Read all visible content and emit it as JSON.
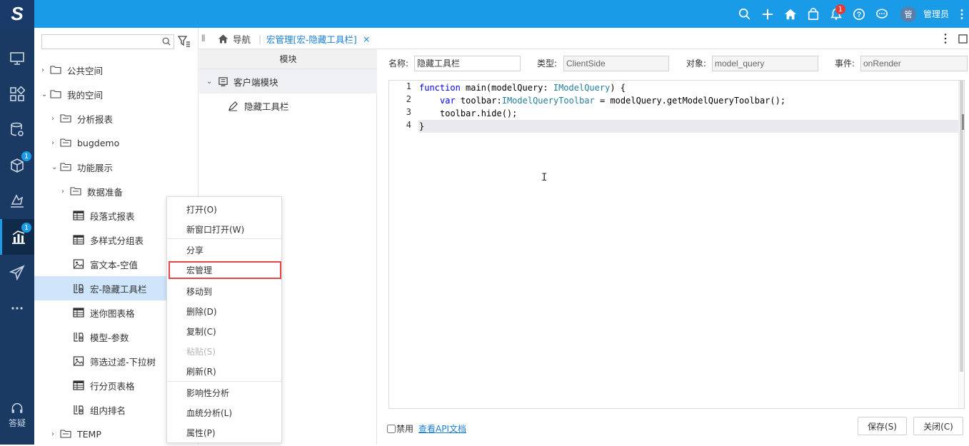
{
  "app": {
    "logo_text": "S",
    "user_avatar": "管",
    "user_name": "管理员",
    "notify_count": "1"
  },
  "sidebar": {
    "badge_resource": "1",
    "badge_analysis": "1",
    "help_label": "答疑"
  },
  "tree": {
    "search_placeholder": "",
    "items": [
      {
        "label": "公共空间"
      },
      {
        "label": "我的空间"
      },
      {
        "label": "分析报表"
      },
      {
        "label": "bugdemo"
      },
      {
        "label": "功能展示"
      },
      {
        "label": "数据准备"
      },
      {
        "label": "段落式报表"
      },
      {
        "label": "多样式分组表"
      },
      {
        "label": "富文本-空值"
      },
      {
        "label": "宏-隐藏工具栏"
      },
      {
        "label": "迷你图表格"
      },
      {
        "label": "模型-参数"
      },
      {
        "label": "筛选过滤-下拉树"
      },
      {
        "label": "行分页表格"
      },
      {
        "label": "组内排名"
      },
      {
        "label": "TEMP"
      }
    ]
  },
  "context_menu": {
    "items": [
      {
        "label": "打开(O)"
      },
      {
        "label": "新窗口打开(W)"
      },
      {
        "label": "分享"
      },
      {
        "label": "宏管理"
      },
      {
        "label": "移动到"
      },
      {
        "label": "删除(D)"
      },
      {
        "label": "复制(C)"
      },
      {
        "label": "粘贴(S)"
      },
      {
        "label": "刷新(R)"
      },
      {
        "label": "影响性分析"
      },
      {
        "label": "血统分析(L)"
      },
      {
        "label": "属性(P)"
      }
    ]
  },
  "tabs": {
    "nav_label": "导航",
    "active_tab": "宏管理[宏-隐藏工具栏]",
    "close": "×"
  },
  "modules": {
    "header": "模块",
    "group": "客户端模块",
    "item": "隐藏工具栏"
  },
  "form": {
    "name_label": "名称:",
    "name_value": "隐藏工具栏",
    "type_label": "类型:",
    "type_value": "ClientSide",
    "object_label": "对象:",
    "object_value": "model_query",
    "event_label": "事件:",
    "event_value": "onRender"
  },
  "editor": {
    "line_numbers": [
      "1",
      "2",
      "3",
      "4"
    ],
    "code": {
      "l1_kw": "function",
      "l1_a": " main(modelQuery: ",
      "l1_ty": "IModelQuery",
      "l1_b": ") {",
      "l2_kw": "var",
      "l2_a": " toolbar:",
      "l2_ty": "IModelQueryToolbar",
      "l2_b": " = modelQuery.getModelQueryToolbar();",
      "l3": "toolbar.hide();",
      "l4": "}"
    }
  },
  "footer": {
    "disable_label": "禁用",
    "api_link": "查看API文档",
    "save_label": "保存(S)",
    "close_label": "关闭(C)"
  },
  "colors": {
    "topbar": "#1a9be8",
    "sidenav": "#1b3a63",
    "selected": "#cfe5fb",
    "highlight": "#e24848"
  }
}
